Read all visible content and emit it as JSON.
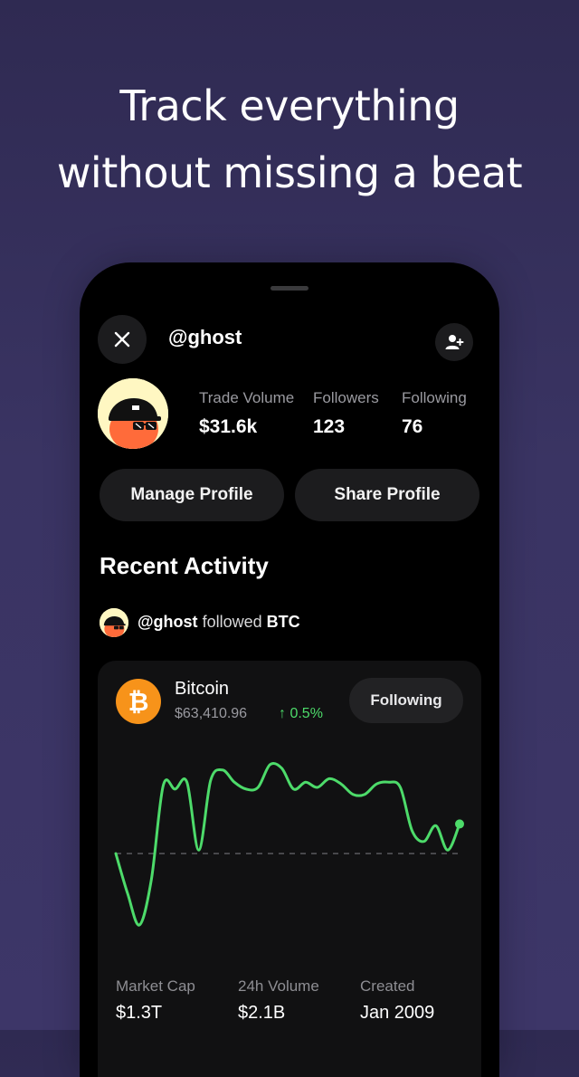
{
  "headline": {
    "line1": "Track everything",
    "line2": "without missing a beat"
  },
  "profile": {
    "handle": "@ghost",
    "stats": [
      {
        "label": "Trade Volume",
        "value": "$31.6k"
      },
      {
        "label": "Followers",
        "value": "123"
      },
      {
        "label": "Following",
        "value": "76"
      }
    ],
    "manage_label": "Manage Profile",
    "share_label": "Share Profile"
  },
  "recent": {
    "title": "Recent Activity",
    "activity": {
      "user": "@ghost",
      "action": "followed",
      "target": "BTC"
    }
  },
  "coin": {
    "symbol_glyph": "₿",
    "name": "Bitcoin",
    "price": "$63,410.96",
    "change": "0.5%",
    "change_arrow": "↑",
    "follow_label": "Following",
    "accent_color": "#4ddb6a",
    "icon_color": "#f7931a"
  },
  "chart_data": {
    "type": "line",
    "title": "",
    "xlabel": "",
    "ylabel": "",
    "grid": false,
    "baseline_dashed": true,
    "y": [
      63100,
      62870,
      62690,
      62950,
      63490,
      63470,
      63510,
      63120,
      63520,
      63580,
      63510,
      63470,
      63480,
      63610,
      63590,
      63470,
      63510,
      63480,
      63530,
      63500,
      63440,
      63440,
      63500,
      63510,
      63480,
      63230,
      63170,
      63260,
      63120,
      63270
    ],
    "baseline": 63100
  },
  "metrics": [
    {
      "label": "Market Cap",
      "value": "$1.3T"
    },
    {
      "label": "24h Volume",
      "value": "$2.1B"
    },
    {
      "label": "Created",
      "value": "Jan 2009"
    }
  ]
}
